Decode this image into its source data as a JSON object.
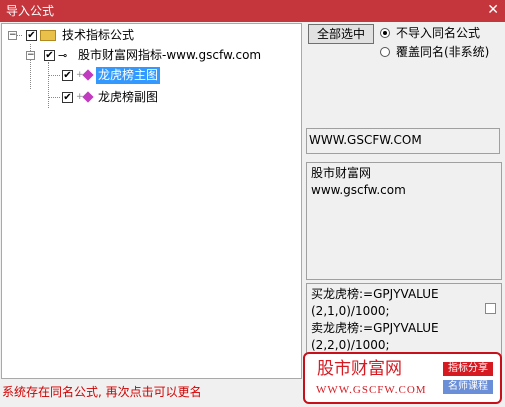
{
  "window": {
    "title": "导入公式",
    "close_glyph": "✕"
  },
  "tree": {
    "root_label": "技术指标公式",
    "group_label": "股市财富网指标-www.gscfw.com",
    "items": [
      {
        "label": "龙虎榜主图",
        "selected": true
      },
      {
        "label": "龙虎榜副图",
        "selected": false
      }
    ]
  },
  "options": {
    "select_all_label": "全部选中",
    "radio_skip_label": "不导入同名公式",
    "radio_overwrite_label": "覆盖同名(非系统)",
    "selected_option": "skip"
  },
  "info": {
    "url_text": "WWW.GSCFW.COM",
    "desc_line1": "股市财富网",
    "desc_line2": "www.gscfw.com",
    "formula_line1": "买龙虎榜:=GPJYVALUE",
    "formula_line2": "(2,1,0)/1000;",
    "formula_line3": "卖龙虎榜:=GPJYVALUE",
    "formula_line4": "(2,2,0)/1000;"
  },
  "status_text": "系统存在同名公式, 再次点击可以更名",
  "promo": {
    "title": "股市财富网",
    "url": "WWW.GSCFW.COM",
    "tag1": "指标分享",
    "tag2": "名师课程",
    "tag1_color": "#d61a22",
    "tag2_color": "#6a8fd8"
  }
}
